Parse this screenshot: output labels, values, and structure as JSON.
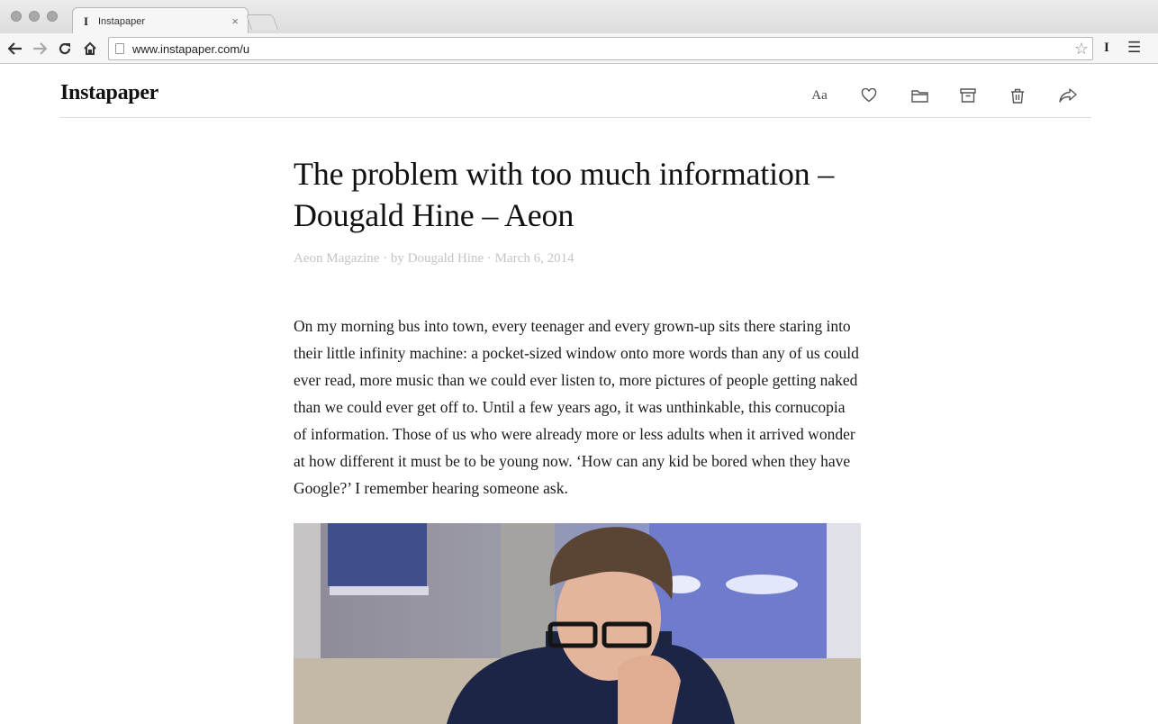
{
  "browser": {
    "tab_title": "Instapaper",
    "tab_close": "×",
    "url": "www.instapaper.com/u",
    "icons": {
      "back": "back-arrow-icon",
      "forward": "forward-arrow-icon",
      "reload": "reload-icon",
      "home": "home-icon",
      "page": "page-icon",
      "bookmark": "star-icon",
      "extension": "instapaper-extension-icon",
      "menu": "hamburger-menu-icon"
    },
    "extension_label": "I"
  },
  "header": {
    "logo": "Instapaper",
    "actions": [
      {
        "name": "text-settings",
        "label": "Aa",
        "icon": "font-size-icon"
      },
      {
        "name": "like",
        "icon": "heart-icon"
      },
      {
        "name": "move-to-folder",
        "icon": "folder-icon"
      },
      {
        "name": "archive",
        "icon": "archive-box-icon"
      },
      {
        "name": "delete",
        "icon": "trash-icon"
      },
      {
        "name": "share",
        "icon": "share-arrow-icon"
      }
    ]
  },
  "article": {
    "title": "The problem with too much information – Dougald Hine – Aeon",
    "meta": "Aeon Magazine · by Dougald Hine · March 6, 2014",
    "paragraph": "On my morning bus into town, every teenager and every grown-up sits there staring into their little infinity machine: a pocket-sized window onto more words than any of us could ever read, more music than we could ever listen to, more pictures of people getting naked than we could ever get off to. Until a few years ago, it was unthinkable, this cornucopia of information. Those of us who were already more or less adults when it arrived wonder at how different it must be to be young now. ‘How can any kid be bored when they have Google?’ I remember hearing someone ask."
  },
  "colors": {
    "text": "#111111",
    "meta": "#c4c4c4",
    "divider": "#dcdcdc",
    "chrome": "#f6f6f6"
  }
}
